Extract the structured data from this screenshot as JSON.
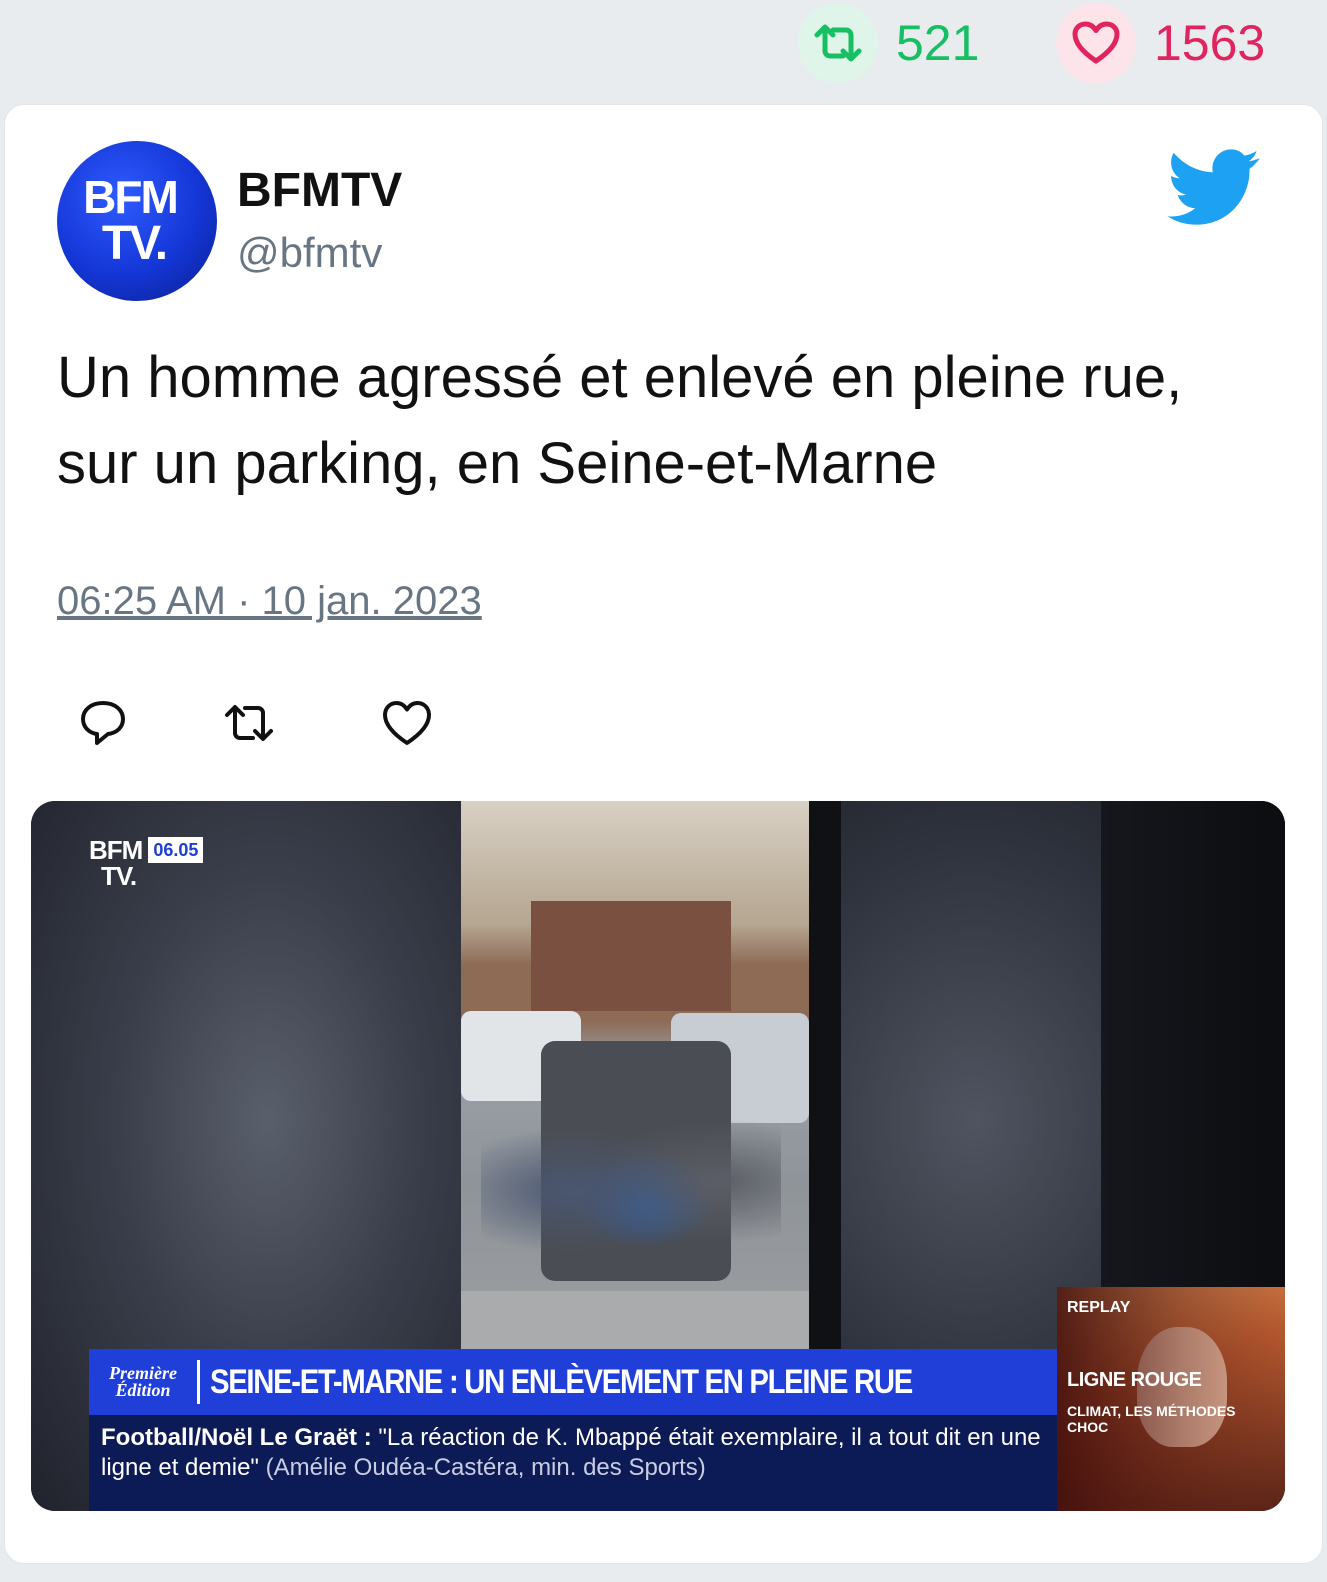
{
  "stats": {
    "retweets": "521",
    "likes": "1563"
  },
  "tweet": {
    "author_name": "BFMTV",
    "author_handle": "@bfmtv",
    "avatar_text_line1": "BFM",
    "avatar_text_line2": "TV.",
    "text": "Un homme agressé et enlevé en pleine rue, sur un parking, en Seine-et-Marne",
    "timestamp": "06:25 AM · 10 jan. 2023"
  },
  "media": {
    "channel_logo_line1": "BFM",
    "channel_logo_line2": "TV.",
    "clock": "06.05",
    "show_name": "Première Édition",
    "headline": "SEINE-ET-MARNE : UN ENLÈVEMENT EN PLEINE RUE",
    "ticker_topic": "Football/Noël Le Graët :",
    "ticker_quote": "\"La réaction de K. Mbappé était exemplaire, il a tout dit en une ligne et demie\"",
    "ticker_source": "(Amélie Oudéa-Castéra, min. des Sports)",
    "replay_label": "REPLAY",
    "replay_title": "LIGNE ROUGE",
    "replay_subtitle": "CLIMAT, LES MÉTHODES CHOC"
  },
  "icons": {
    "retweet": "retweet-icon",
    "like": "heart-icon",
    "reply": "reply-icon",
    "brand": "twitter-bird-icon"
  },
  "colors": {
    "retweet_green": "#17bf63",
    "like_red": "#e0245e",
    "twitter_blue": "#1da1f2",
    "bfm_blue": "#1f3fd8"
  }
}
